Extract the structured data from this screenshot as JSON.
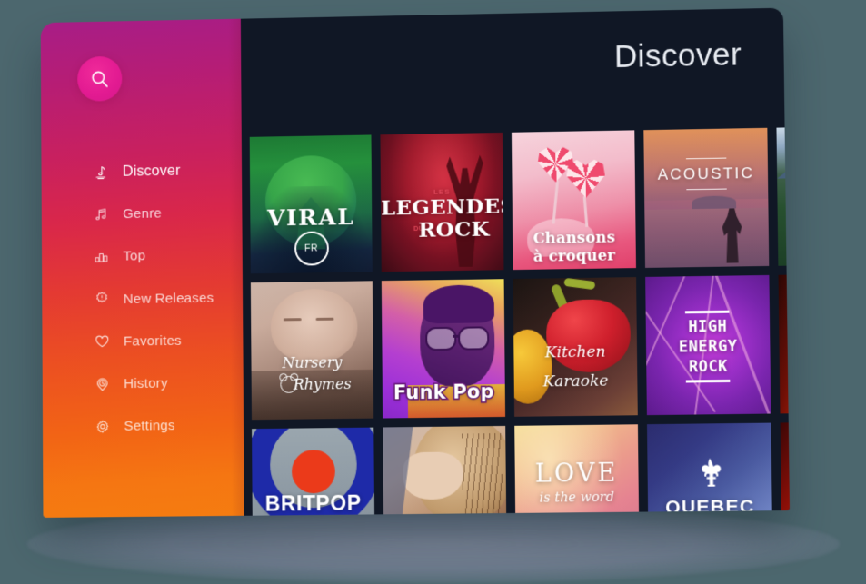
{
  "background_color": "#4c676e",
  "app": {
    "panel_color": "#101725",
    "sidebar_gradient_from": "#a81d86",
    "sidebar_gradient_to": "#f57c10",
    "accent_color": "#e31b92"
  },
  "header": {
    "title": "Discover"
  },
  "search": {
    "icon": "search-icon",
    "label": "Search"
  },
  "sidebar": {
    "items": [
      {
        "label": "Discover",
        "icon": "music-note-icon",
        "active": true
      },
      {
        "label": "Genre",
        "icon": "double-note-icon",
        "active": false
      },
      {
        "label": "Top",
        "icon": "bar-chart-icon",
        "active": false
      },
      {
        "label": "New Releases",
        "icon": "sparkle-badge-icon",
        "active": false
      },
      {
        "label": "Favorites",
        "icon": "heart-icon",
        "active": false
      },
      {
        "label": "History",
        "icon": "clock-pin-icon",
        "active": false
      },
      {
        "label": "Settings",
        "icon": "gear-icon",
        "active": false
      }
    ]
  },
  "grid": {
    "tiles": [
      {
        "id": "viral",
        "title": "VIRAL",
        "badge": "FR",
        "subtitle": ""
      },
      {
        "id": "legends",
        "title": "LEGENDES",
        "title2": "ROCK",
        "kicker": "LES",
        "connector": "DU"
      },
      {
        "id": "chansons",
        "title": "Chansons",
        "title2": "à croquer"
      },
      {
        "id": "acoustic",
        "title": "ACOUSTIC"
      },
      {
        "id": "nature",
        "title": ""
      },
      {
        "id": "nursery",
        "title": "Nursery",
        "title2": "Rhymes"
      },
      {
        "id": "funkpop",
        "title": "Funk Pop"
      },
      {
        "id": "kitchen",
        "title": "Kitchen",
        "title2": "Karaoke"
      },
      {
        "id": "highenergy",
        "title": "HIGH",
        "title2": "ENERGY",
        "title3": "ROCK"
      },
      {
        "id": "fire",
        "title": ""
      },
      {
        "id": "britpop",
        "title": "BRITPOP"
      },
      {
        "id": "handguitar",
        "title": ""
      },
      {
        "id": "love",
        "title": "LOVE",
        "title2": "is the word"
      },
      {
        "id": "quebec",
        "title": "QUEBEC"
      },
      {
        "id": "red",
        "title": ""
      }
    ]
  }
}
